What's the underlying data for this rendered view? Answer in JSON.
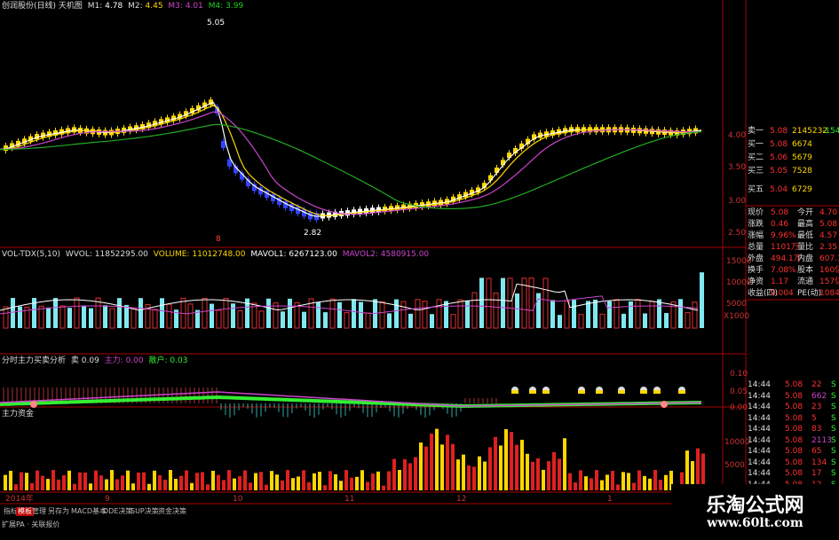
{
  "header": {
    "title": "创润股份(日线) 天机图",
    "m1_label": "M1:",
    "m1": "4.78",
    "m2_label": "M2:",
    "m2": "4.45",
    "m3_label": "M3:",
    "m3": "4.01",
    "m4_label": "M4:",
    "m4": "3.99",
    "high_mark": "5.05",
    "low_mark": "2.82",
    "date_mark": "8"
  },
  "price_axis": [
    "4.00",
    "3.50",
    "3.00",
    "2.50"
  ],
  "vol_header": {
    "name": "VOL-TDX(5,10)",
    "wvol": "WVOL: 11852295.00",
    "volume": "VOLUME: 11012748.00",
    "mavol1": "MAVOL1: 6267123.00",
    "mavol2": "MAVOL2: 4580915.00"
  },
  "vol_axis": [
    "15000",
    "10000",
    "5000",
    "X1000"
  ],
  "ind_header": {
    "name": "分时主力买卖分析",
    "v1": "卖 0.09",
    "v2": "主力: 0.00",
    "v3": "散户: 0.03"
  },
  "ind_axis": [
    "0.10",
    "0.05",
    "0.00"
  ],
  "cap_header": "主力资金",
  "cap_axis": [
    "10000",
    "5000"
  ],
  "date_axis": [
    "2014年",
    "9",
    "10",
    "11",
    "12",
    "1"
  ],
  "order_book": [
    {
      "label": "卖一",
      "price": "5.08",
      "vol": "2145232",
      "delta": "-15417"
    },
    {
      "label": "卖二",
      "price": "",
      "vol": "",
      "delta": ""
    },
    {
      "label": "买一",
      "price": "5.08",
      "vol": "6674",
      "delta": ""
    },
    {
      "label": "买二",
      "price": "5.06",
      "vol": "5679",
      "delta": ""
    },
    {
      "label": "买三",
      "price": "5.05",
      "vol": "7528",
      "delta": ""
    },
    {
      "label": "买四",
      "price": "5.05",
      "vol": "7528",
      "delta": ""
    },
    {
      "label": "买五",
      "price": "5.04",
      "vol": "6729",
      "delta": ""
    }
  ],
  "quote": [
    {
      "l1": "现价",
      "v1": "5.08",
      "l2": "今开",
      "v2": "4.70"
    },
    {
      "l1": "涨跌",
      "v1": "0.46",
      "l2": "最高",
      "v2": "5.08"
    },
    {
      "l1": "涨幅",
      "v1": "9.96%",
      "l2": "最低",
      "v2": "4.57"
    },
    {
      "l1": "总量",
      "v1": "1101万",
      "l2": "量比",
      "v2": "2.35"
    },
    {
      "l1": "外盘",
      "v1": "494.1万",
      "l2": "内盘",
      "v2": "607.1万"
    },
    {
      "l1": "换手",
      "v1": "7.08%",
      "l2": "股本",
      "v2": "160亿"
    },
    {
      "l1": "净资",
      "v1": "1.17",
      "l2": "流通",
      "v2": "157亿"
    },
    {
      "l1": "收益(四)",
      "v1": "0.004",
      "l2": "PE(动)",
      "v2": "1084.3"
    }
  ],
  "ticks": [
    {
      "t": "14:44",
      "p": "5.08",
      "v": "22",
      "s": "S"
    },
    {
      "t": "14:44",
      "p": "5.08",
      "v": "662",
      "s": "S"
    },
    {
      "t": "14:44",
      "p": "5.08",
      "v": "23",
      "s": "S"
    },
    {
      "t": "14:44",
      "p": "5.08",
      "v": "5",
      "s": "S"
    },
    {
      "t": "14:44",
      "p": "5.08",
      "v": "83",
      "s": "S"
    },
    {
      "t": "14:44",
      "p": "5.08",
      "v": "2113",
      "s": "S"
    },
    {
      "t": "14:44",
      "p": "5.08",
      "v": "65",
      "s": "S"
    },
    {
      "t": "14:44",
      "p": "5.08",
      "v": "134",
      "s": "S"
    },
    {
      "t": "14:44",
      "p": "5.08",
      "v": "17",
      "s": "S"
    },
    {
      "t": "14:44",
      "p": "5.08",
      "v": "12",
      "s": "S"
    }
  ],
  "bottom_tabs": [
    "指标",
    "模板",
    "管理",
    "另存为",
    "MACD基本",
    "DDE决策",
    "SUP决策",
    "资金决策"
  ],
  "bottom_status": "扩展PA · 关联报价",
  "watermark": {
    "title": "乐淘公式网",
    "url": "www.60lt.com"
  },
  "colors": {
    "up": "#ff3030",
    "down": "#50e0ff",
    "ma_yellow": "#ffd700",
    "ma_purple": "#cc44cc",
    "ma_green": "#22aa22",
    "vol_cyan": "#80e8f0",
    "ind_green": "#33ee33"
  }
}
